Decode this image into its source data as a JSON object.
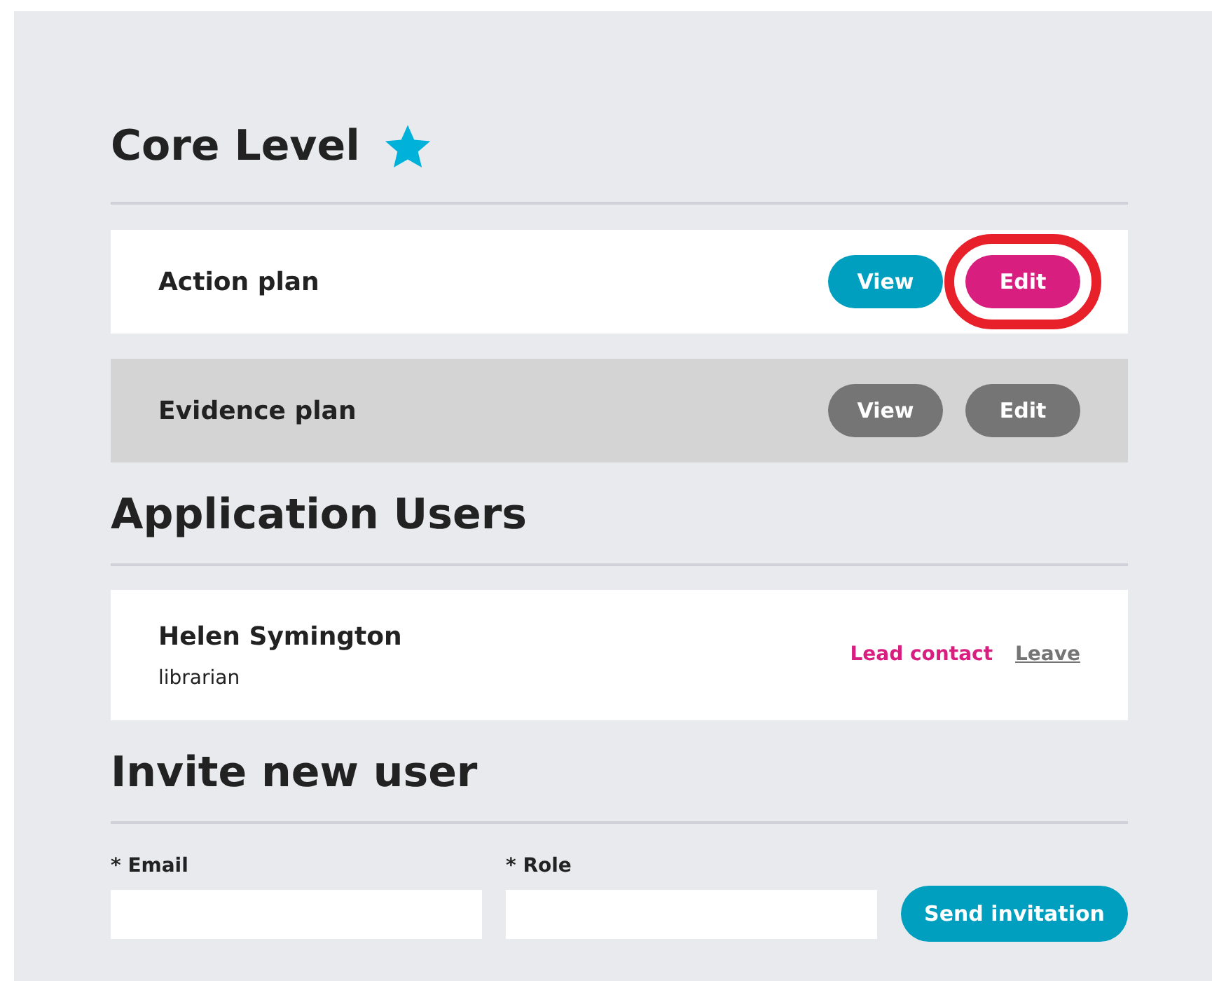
{
  "core_level": {
    "title": "Core Level",
    "starred": true
  },
  "plans": [
    {
      "name": "Action plan",
      "disabled": false,
      "view_label": "View",
      "edit_label": "Edit",
      "edit_highlighted": true
    },
    {
      "name": "Evidence plan",
      "disabled": true,
      "view_label": "View",
      "edit_label": "Edit",
      "edit_highlighted": false
    }
  ],
  "users_section": {
    "title": "Application Users"
  },
  "users": [
    {
      "name": "Helen Symington",
      "role": "librarian",
      "status": "Lead contact",
      "action": "Leave"
    }
  ],
  "invite": {
    "title": "Invite new user",
    "fields": [
      {
        "label": "* Email"
      },
      {
        "label": "* Role"
      }
    ],
    "button": "Send invitation"
  }
}
